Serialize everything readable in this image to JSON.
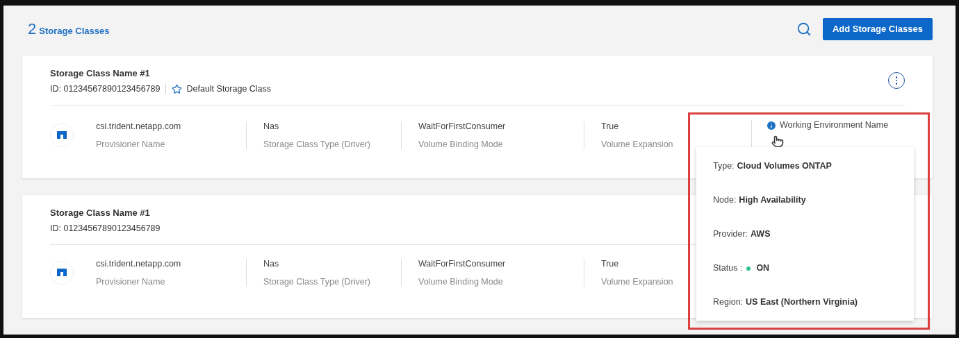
{
  "header": {
    "count": "2",
    "title": "Storage Classes",
    "add_button": "Add Storage Classes"
  },
  "storage_classes": [
    {
      "name": "Storage Class Name #1",
      "id": "ID: 01234567890123456789",
      "default_label": "Default Storage Class",
      "menu": true,
      "fields": [
        {
          "value": "csi.trident.netapp.com",
          "label": "Provisioner Name"
        },
        {
          "value": "Nas",
          "label": "Storage Class Type (Driver)"
        },
        {
          "value": "WaitForFirstConsumer",
          "label": "Volume Binding Mode"
        },
        {
          "value": "True",
          "label": "Volume Expansion"
        }
      ],
      "working_environment": "Working Environment Name"
    },
    {
      "name": "Storage Class Name #1",
      "id": "ID: 01234567890123456789",
      "menu": false,
      "fields": [
        {
          "value": "csi.trident.netapp.com",
          "label": "Provisioner Name"
        },
        {
          "value": "Nas",
          "label": "Storage Class Type (Driver)"
        },
        {
          "value": "WaitForFirstConsumer",
          "label": "Volume Binding Mode"
        },
        {
          "value": "True",
          "label": "Volume Expansion"
        }
      ]
    }
  ],
  "tooltip": {
    "rows": [
      {
        "kind": "text",
        "label": "Type:",
        "value": "Cloud Volumes ONTAP"
      },
      {
        "kind": "text",
        "label": "Node:",
        "value": "High Availability"
      },
      {
        "kind": "text",
        "label": "Provider:",
        "value": "AWS"
      },
      {
        "kind": "status",
        "label": "Status :",
        "value": "ON",
        "color": "#2ebf8a"
      },
      {
        "kind": "text",
        "label": "Region:",
        "value": "US East (Northern Virginia)"
      }
    ]
  }
}
